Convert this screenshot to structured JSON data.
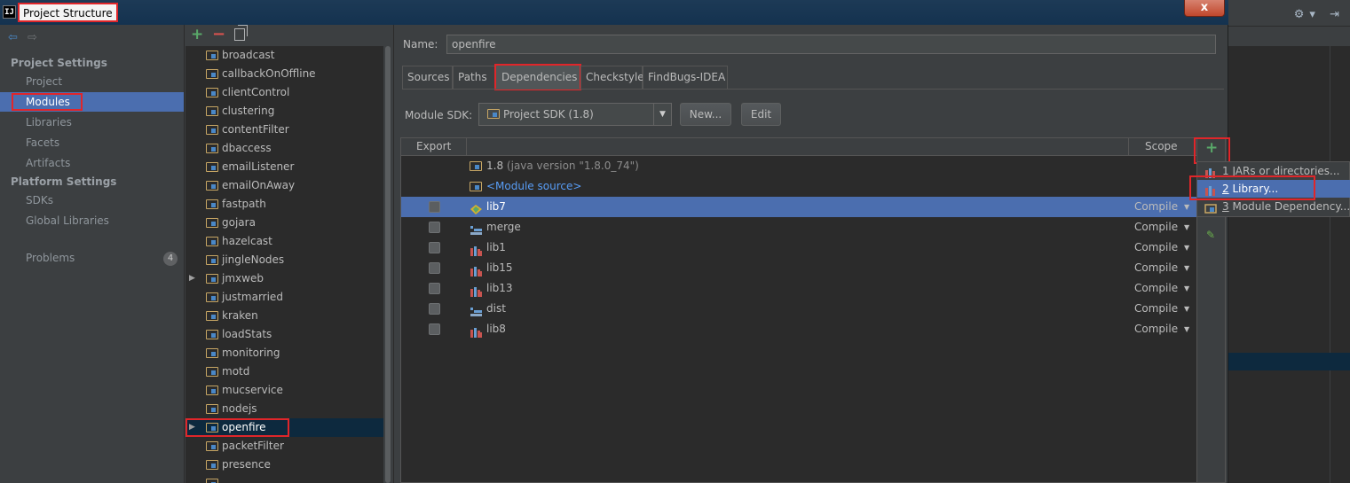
{
  "window": {
    "title": "Project Structure",
    "logo": "IJ",
    "close_label": "x"
  },
  "nav": {
    "back_icon": "back-arrow",
    "forward_icon": "forward-arrow",
    "project_settings_heading": "Project Settings",
    "project_settings_items": [
      "Project",
      "Modules",
      "Libraries",
      "Facets",
      "Artifacts"
    ],
    "platform_settings_heading": "Platform Settings",
    "platform_settings_items": [
      "SDKs",
      "Global Libraries"
    ],
    "problems_label": "Problems",
    "problems_count": "4",
    "selected": "Modules"
  },
  "modules": {
    "toolbar": {
      "add": "+",
      "remove": "−"
    },
    "items": [
      "broadcast",
      "callbackOnOffline",
      "clientControl",
      "clustering",
      "contentFilter",
      "dbaccess",
      "emailListener",
      "emailOnAway",
      "fastpath",
      "gojara",
      "hazelcast",
      "jingleNodes",
      "jmxweb",
      "justmarried",
      "kraken",
      "loadStats",
      "monitoring",
      "motd",
      "mucservice",
      "nodejs",
      "openfire",
      "packetFilter",
      "presence"
    ],
    "expandable": [
      "jmxweb",
      "openfire"
    ],
    "selected": "openfire"
  },
  "content": {
    "name_label": "Name:",
    "name_value": "openfire",
    "tabs": [
      "Sources",
      "Paths",
      "Dependencies",
      "Checkstyle",
      "FindBugs-IDEA"
    ],
    "active_tab": "Dependencies",
    "sdk_label": "Module SDK:",
    "sdk_value": "Project SDK (1.8)",
    "new_button": "New...",
    "edit_button": "Edit"
  },
  "dependencies": {
    "columns": {
      "export": "Export",
      "scope": "Scope"
    },
    "jdk_row": {
      "name": "1.8",
      "detail": "(java version \"1.8.0_74\")"
    },
    "source_row": {
      "name": "<Module source>"
    },
    "rows": [
      {
        "name": "lib7",
        "scope": "Compile",
        "icon": "library-colored-icon",
        "selected": true
      },
      {
        "name": "merge",
        "scope": "Compile",
        "icon": "artifact-icon",
        "selected": false
      },
      {
        "name": "lib1",
        "scope": "Compile",
        "icon": "library-icon",
        "selected": false
      },
      {
        "name": "lib15",
        "scope": "Compile",
        "icon": "library-icon",
        "selected": false
      },
      {
        "name": "lib13",
        "scope": "Compile",
        "icon": "library-icon",
        "selected": false
      },
      {
        "name": "dist",
        "scope": "Compile",
        "icon": "artifact-icon",
        "selected": false
      },
      {
        "name": "lib8",
        "scope": "Compile",
        "icon": "library-icon",
        "selected": false
      }
    ],
    "side_add": "+"
  },
  "popup": {
    "items": [
      {
        "num": "1",
        "label": "JARs or directories..."
      },
      {
        "num": "2",
        "label": "Library..."
      },
      {
        "num": "3",
        "label": "Module Dependency..."
      }
    ],
    "selected_index": 1
  },
  "colors": {
    "highlight_red": "#e0262a",
    "selection_blue": "#4b6eaf",
    "add_green": "#59a869"
  }
}
